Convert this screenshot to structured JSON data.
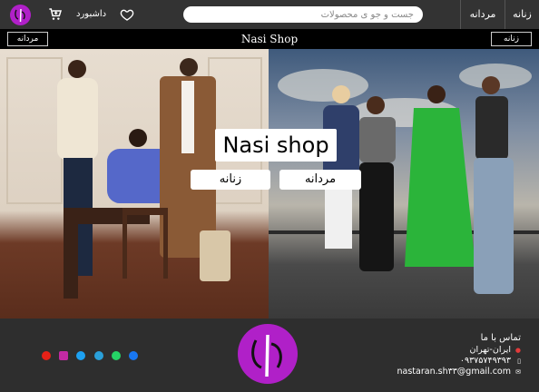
{
  "nav": {
    "women_label": "زنانه",
    "men_label": "مردانه",
    "search_placeholder": "جست و جو ی محصولات",
    "dashboard_label": "داشبورد"
  },
  "subbar": {
    "men_label": "مردانه",
    "women_label": "زنانه",
    "brand": "Nasi Shop"
  },
  "hero": {
    "title": "Nasi shop",
    "men_label": "مردانه",
    "women_label": "زنانه"
  },
  "footer": {
    "contact_title": "تماس با ما",
    "location": "ایران-تهران",
    "phone": "۰۹۳۷۵۷۴۹۳۹۳",
    "email": "nastaran.sh۳۳@gmail.com",
    "socials": [
      "facebook-icon",
      "whatsapp-icon",
      "telegram-icon",
      "twitter-icon",
      "instagram-icon",
      "youtube-icon"
    ]
  },
  "colors": {
    "brand_purple": "#b020c8",
    "nav_bg": "#333333",
    "footer_bg": "#2e2e2e"
  }
}
